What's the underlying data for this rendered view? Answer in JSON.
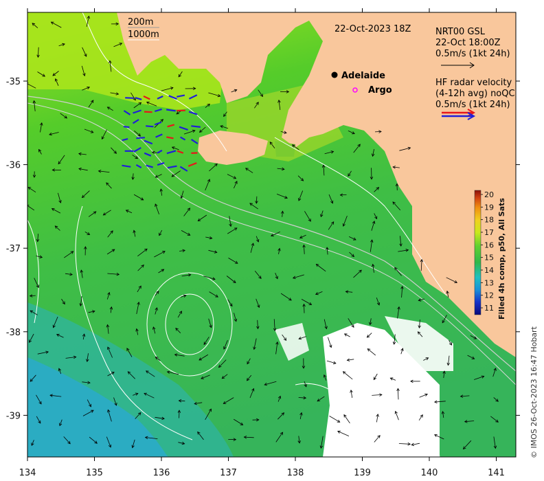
{
  "date_title": "22-Oct-2023 18Z",
  "depth_contours": [
    "200m",
    "1000m"
  ],
  "places": [
    {
      "name": "Adelaide",
      "symbol": "dot"
    },
    {
      "name": "Argo",
      "symbol": "ring"
    }
  ],
  "legend_gsl": {
    "line1": "NRT00 GSL",
    "line2": "22-Oct 18:00Z",
    "line3": "0.5m/s (1kt 24h)"
  },
  "legend_hf": {
    "line1": "HF radar velocity",
    "line2": "(4-12h avg) noQC",
    "line3": "0.5m/s (1kt 24h)"
  },
  "colorbar": {
    "title": "Filled 4h comp, p50, All Sats",
    "ticks": [
      "11",
      "12",
      "13",
      "14",
      "15",
      "16",
      "17",
      "18",
      "19",
      "20"
    ]
  },
  "x_ticks": [
    "134",
    "135",
    "136",
    "137",
    "138",
    "139",
    "140",
    "141"
  ],
  "y_ticks": [
    "-35",
    "-36",
    "-37",
    "-38",
    "-39"
  ],
  "credit": "© IMOS 26-Oct-2023 16:47 Hobart",
  "colors": {
    "land": "#f9c79c",
    "sst_warm": "#b5e61d",
    "sst_mid": "#3cc04a",
    "sst_cool": "#2aa9c8",
    "hf_red": "#e8161a",
    "hf_blue": "#1f1fd8",
    "argo": "#ff00ff"
  }
}
